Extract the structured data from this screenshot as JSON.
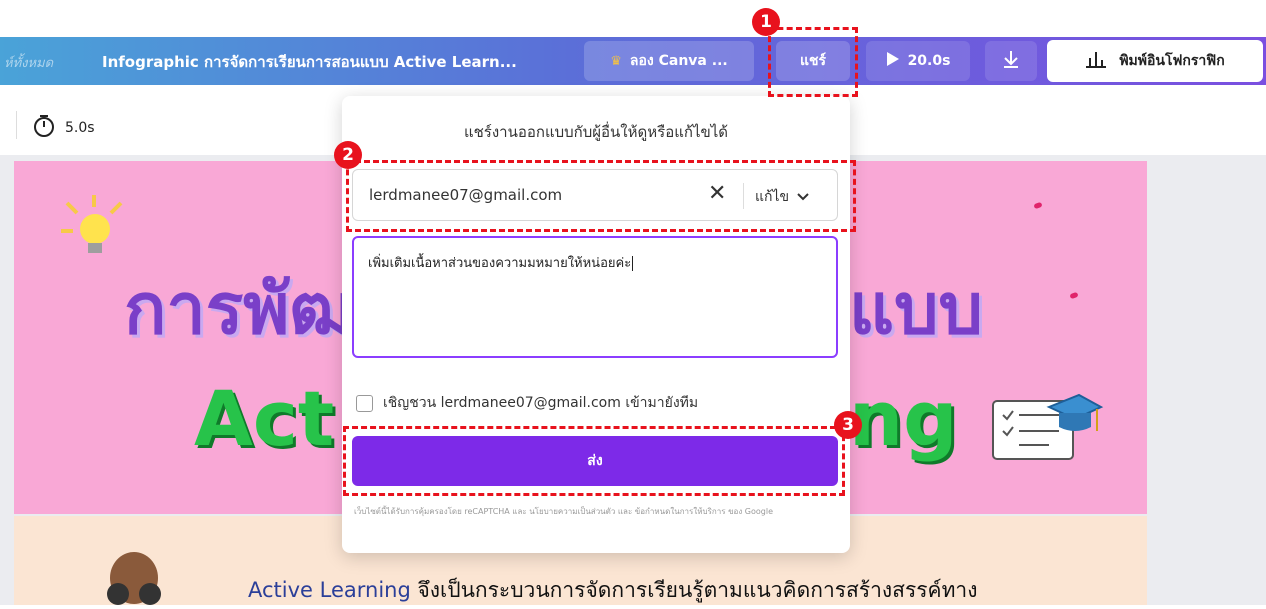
{
  "toolbar": {
    "breadcrumb": "ห์ทั้งหมด",
    "doc_title": "Infographic การจัดการเรียนการสอนแบบ Active Learn...",
    "try_canva": "ลอง Canva ...",
    "share": "แชร์",
    "play_time": "20.0s",
    "print_infographic": "พิมพ์อินโฟกราฟิก"
  },
  "subbar": {
    "timer": "5.0s"
  },
  "share_panel": {
    "title": "แชร์งานออกแบบกับผู้อื่นให้ดูหรือแก้ไขได้",
    "email": "lerdmanee07@gmail.com",
    "permission": "แก้ไข",
    "message": "เพิ่มเติมเนื้อหาส่วนของความมหมายให้หน่อยค่ะ",
    "invite_label": "เชิญชวน lerdmanee07@gmail.com เข้ามายังทีม",
    "send_label": "ส่ง",
    "recaptcha_note": "เว็บไซต์นี้ได้รับการคุ้มครองโดย reCAPTCHA และ นโยบายความเป็นส่วนตัว และ ข้อกำหนดในการให้บริการ ของ Google"
  },
  "slide": {
    "heading_left": "การพัฒ",
    "heading_right": "แบบ",
    "subheading_left": "Act",
    "subheading_right": "ng",
    "bottom_accent": "Active Learning",
    "bottom_text": "จึงเป็นกระบวนการจัดการเรียนรู้ตามแนวคิดการสร้างสรรค์ทาง"
  },
  "annotations": [
    "1",
    "2",
    "3"
  ],
  "colors": {
    "accent": "#7d2ae8",
    "highlight": "#e8121d",
    "slide_bg": "#f9a8d6"
  }
}
